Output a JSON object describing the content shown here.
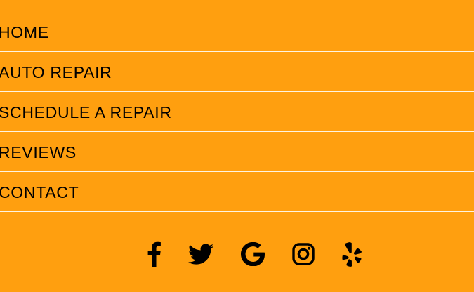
{
  "menu": {
    "items": [
      {
        "label": "HOME"
      },
      {
        "label": "AUTO REPAIR"
      },
      {
        "label": "SCHEDULE A REPAIR"
      },
      {
        "label": "REVIEWS"
      },
      {
        "label": "CONTACT"
      }
    ]
  },
  "social": {
    "icons": [
      "facebook-icon",
      "twitter-icon",
      "google-icon",
      "instagram-icon",
      "yelp-icon"
    ]
  },
  "colors": {
    "background": "#ff9f0f",
    "divider": "#fff4e0",
    "text": "#000000"
  }
}
